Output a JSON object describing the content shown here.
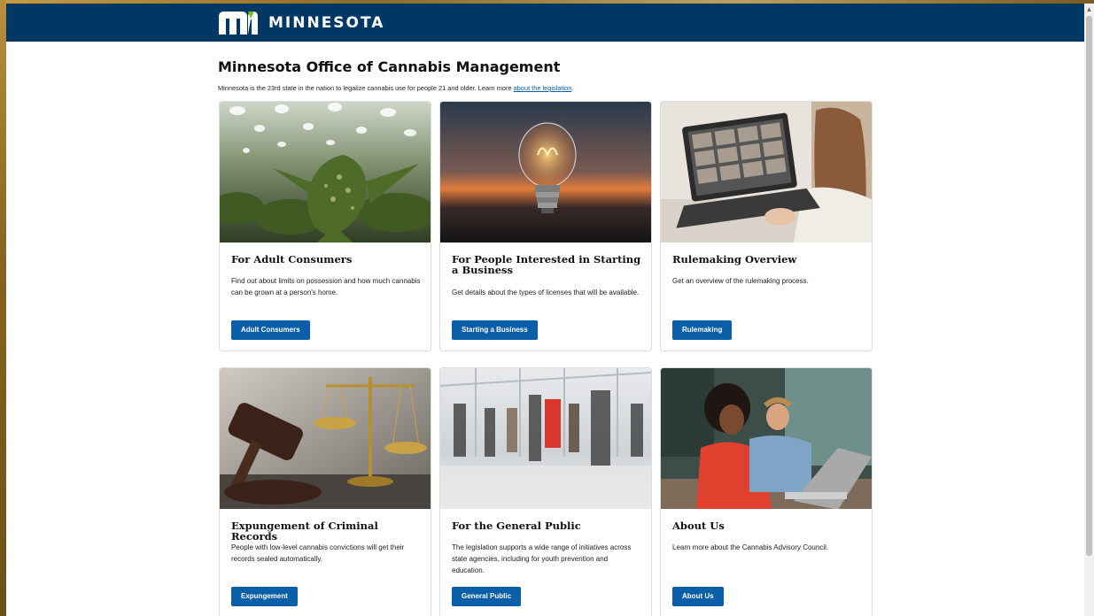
{
  "header": {
    "logo_text": "MINNESOTA",
    "bg_color": "#003865"
  },
  "page": {
    "title": "Minnesota Office of Cannabis Management",
    "intro_text": "Minnesota is the 23rd state in the nation to legalize cannabis use for people 21 and older. Learn more ",
    "intro_link": "about the legislation",
    "intro_end": "."
  },
  "cards": [
    {
      "title": "For Adult Consumers",
      "description": "Find out about limits on possession and how much cannabis can be grown at a person's home.",
      "button": "Adult Consumers",
      "image": "cannabis-plant-image"
    },
    {
      "title": "For People Interested in Starting a Business",
      "description": "Get details about the types of licenses that will be available.",
      "button": "Starting a Business",
      "image": "light-bulb-image"
    },
    {
      "title": "Rulemaking Overview",
      "description": "Get an overview of the rulemaking process.",
      "button": "Rulemaking",
      "image": "video-call-laptop-image"
    },
    {
      "title": "Expungement of Criminal Records",
      "description": "People with low-level cannabis convictions will get their records sealed automatically.",
      "button": "Expungement",
      "image": "gavel-and-scales-image"
    },
    {
      "title": "For the General Public",
      "description": "The legislation supports a wide range of initiatives across state agencies, including for youth prevention and education.",
      "button": "General Public",
      "image": "people-walking-image"
    },
    {
      "title": "About Us",
      "description": "Learn more about the Cannabis Advisory Council.",
      "button": "About Us",
      "image": "people-at-laptop-image"
    }
  ],
  "colors": {
    "button": "#0b5ea8",
    "link": "#0b5ea8"
  }
}
